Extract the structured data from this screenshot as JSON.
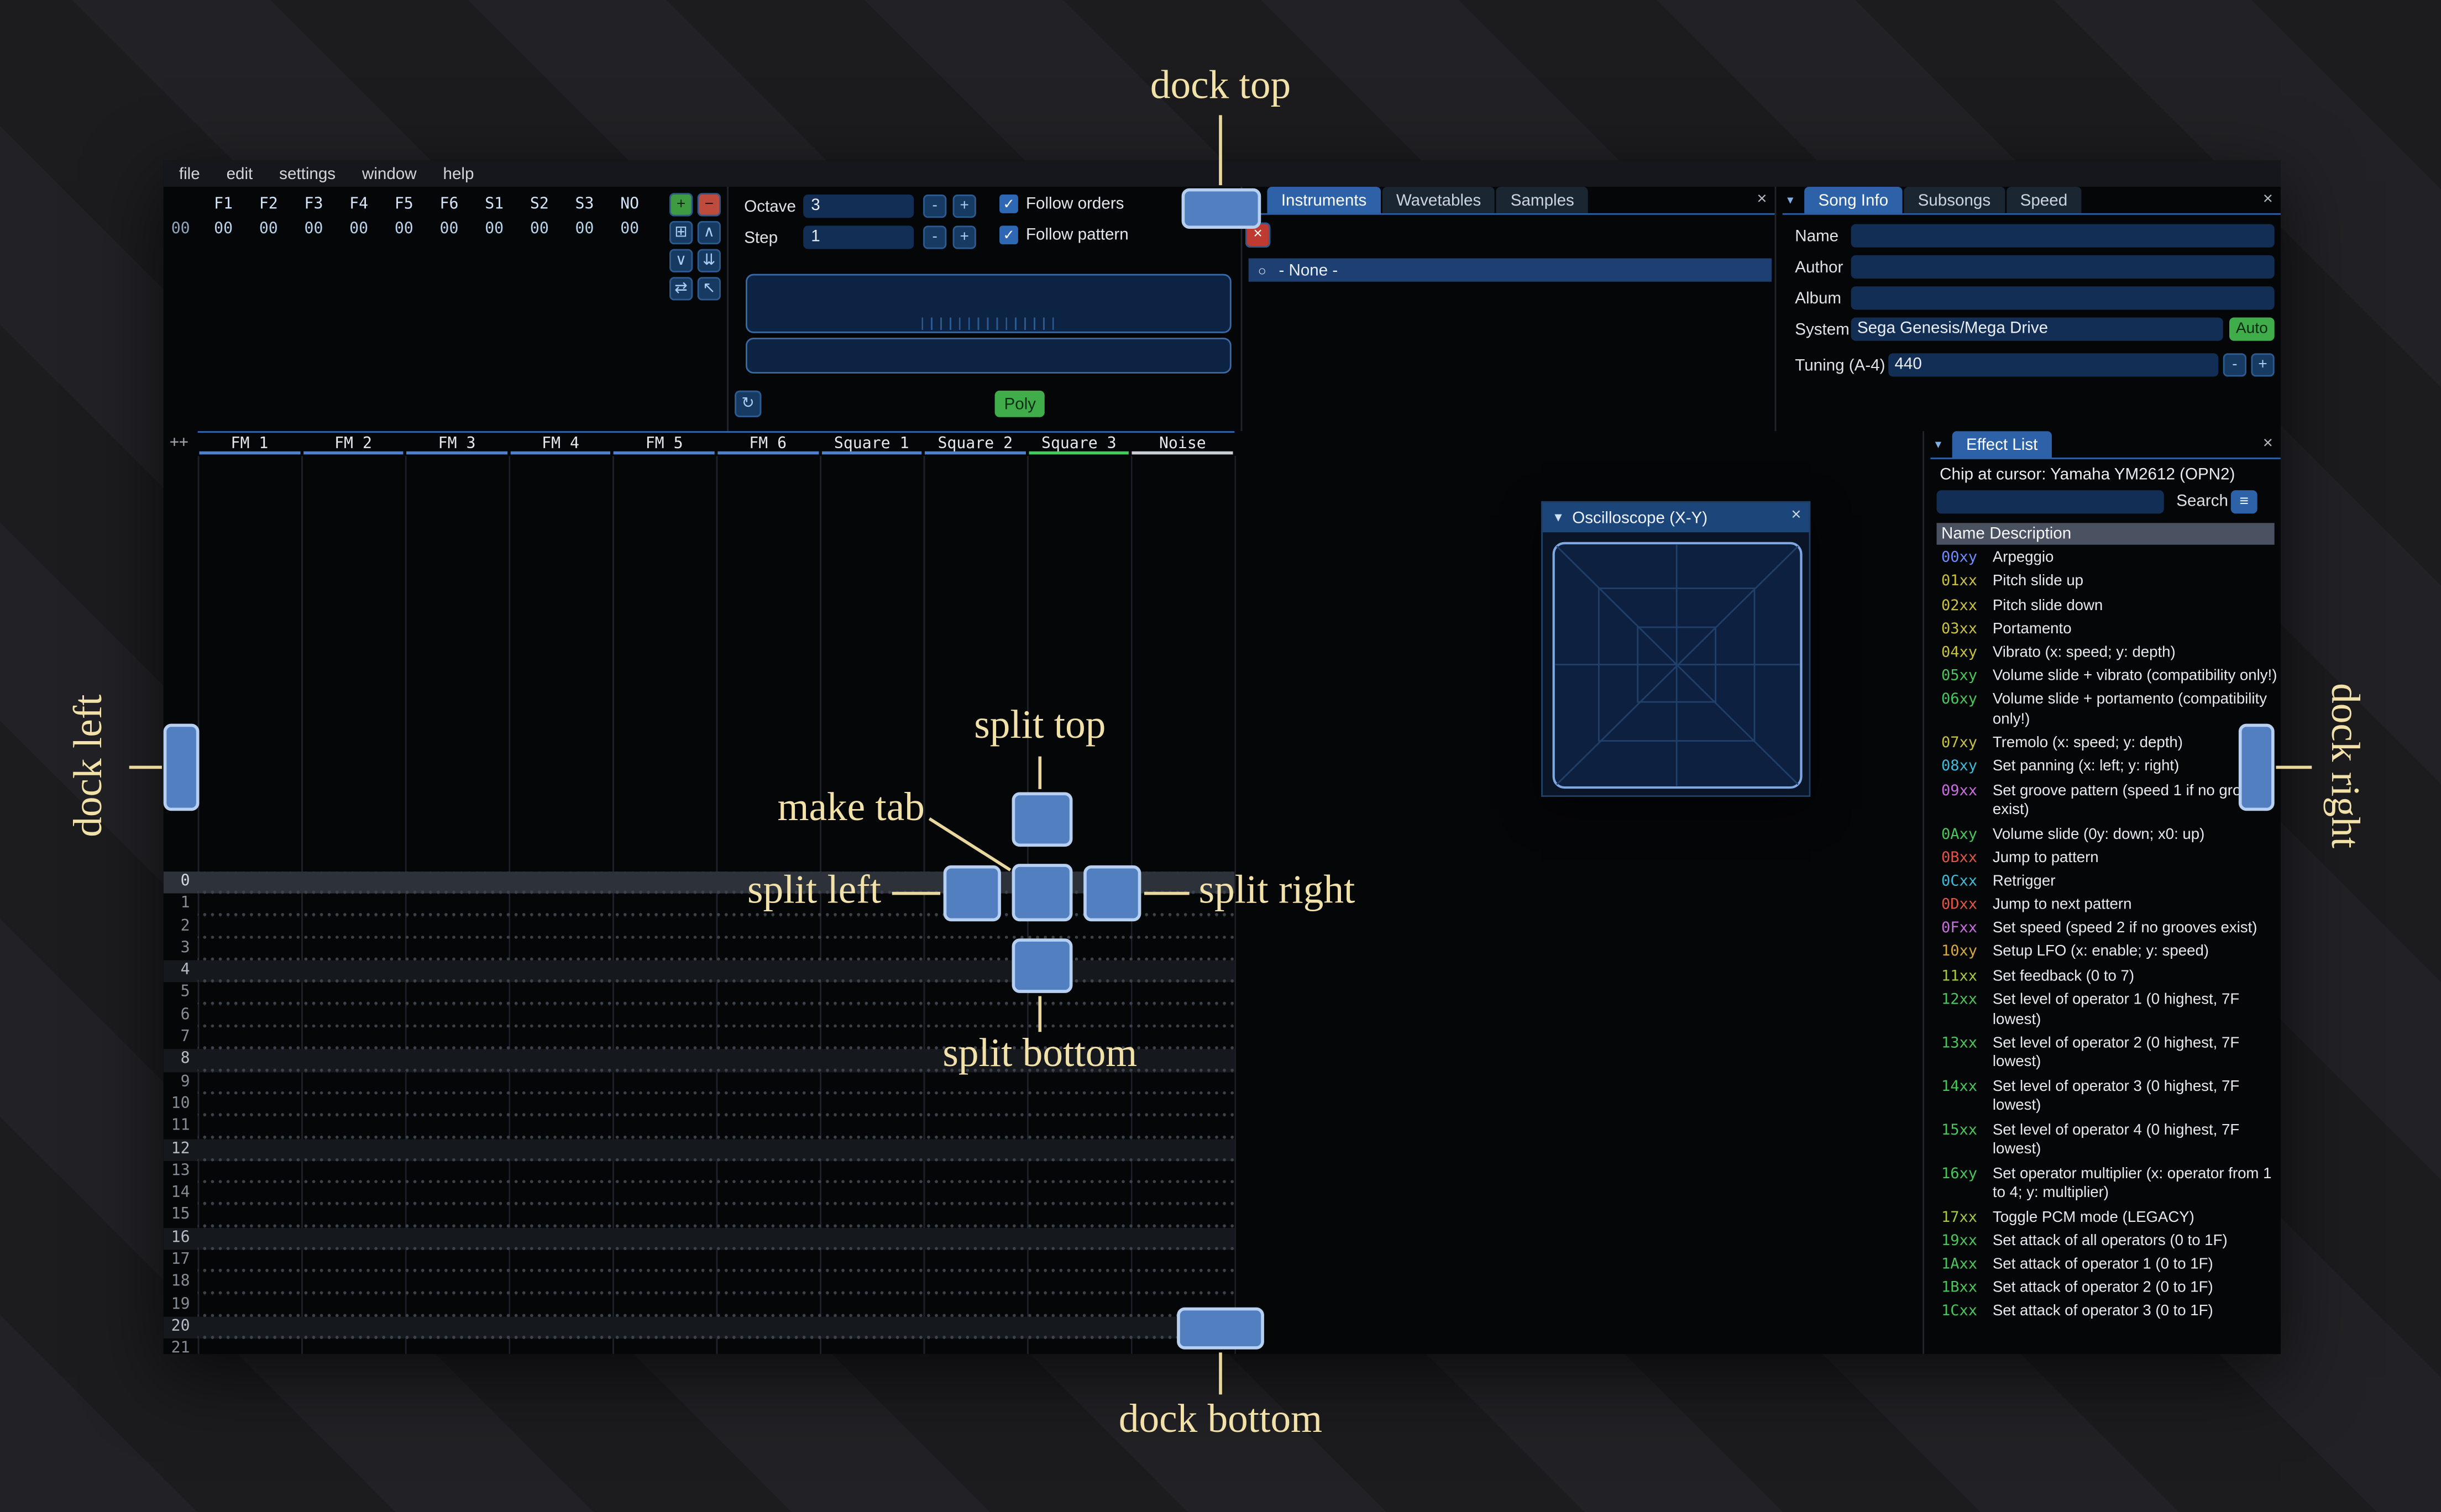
{
  "window": {
    "menu": [
      "file",
      "edit",
      "settings",
      "window",
      "help"
    ]
  },
  "glyphs": {
    "minus": "-",
    "plus": "+",
    "close": "×",
    "tab_menu": "▾",
    "collapse": "▼",
    "radio": "○",
    "hamburger": "≡",
    "check": "✓"
  },
  "orders": {
    "index": "00",
    "columns": [
      "F1",
      "F2",
      "F3",
      "F4",
      "F5",
      "F6",
      "S1",
      "S2",
      "S3",
      "NO"
    ],
    "values": [
      "00",
      "00",
      "00",
      "00",
      "00",
      "00",
      "00",
      "00",
      "00",
      "00"
    ],
    "buttons": [
      {
        "name": "order-add-button",
        "glyph": "+",
        "bg": "#3f9b41",
        "fg": "#0b2510"
      },
      {
        "name": "order-remove-button",
        "glyph": "−",
        "bg": "#bf4a3e",
        "fg": "#2a0c08"
      },
      {
        "name": "order-duplicate-button",
        "glyph": "⊞"
      },
      {
        "name": "order-move-up-button",
        "glyph": "∧"
      },
      {
        "name": "order-move-down-button",
        "glyph": "∨"
      },
      {
        "name": "order-duplicate-end-button",
        "glyph": "⇊"
      },
      {
        "name": "order-change-button",
        "glyph": "⇄"
      },
      {
        "name": "order-edit-button",
        "glyph": "↖"
      }
    ]
  },
  "transport": {
    "octave_label": "Octave",
    "octave_value": "3",
    "step_label": "Step",
    "step_value": "1",
    "follow_orders": "Follow orders",
    "follow_pattern": "Follow pattern",
    "buttons": [
      {
        "name": "play-button",
        "glyph": "▶"
      },
      {
        "name": "play-from-cursor-button",
        "glyph": "◉"
      },
      {
        "name": "play-pattern-button",
        "glyph": "↠"
      },
      {
        "name": "step-row-button",
        "glyph": "↓"
      },
      {
        "name": "record-button",
        "glyph": "●",
        "fg": "#3fd65c"
      },
      {
        "name": "metronome-button",
        "glyph": "♩"
      },
      {
        "name": "repeat-button",
        "glyph": "↻"
      }
    ],
    "poly_label": "Poly"
  },
  "instruments": {
    "tabs": [
      {
        "label": "Instruments",
        "state": "active",
        "name": "tab-instruments"
      },
      {
        "label": "Wavetables",
        "state": "",
        "name": "tab-wavetables"
      },
      {
        "label": "Samples",
        "state": "",
        "name": "tab-samples"
      }
    ],
    "toolbar": [
      {
        "name": "add-instrument-button",
        "glyph": "+"
      },
      {
        "name": "duplicate-instrument-button",
        "glyph": "⊞"
      },
      {
        "name": "open-instrument-button",
        "glyph": "▤"
      },
      {
        "name": "save-instrument-button",
        "glyph": "▦"
      },
      {
        "name": "organize-instruments-button",
        "glyph": "⊟"
      },
      {
        "name": "instrument-up-button",
        "glyph": "↑"
      },
      {
        "name": "instrument-down-button",
        "glyph": "↓"
      },
      {
        "name": "delete-instrument-button",
        "glyph": "×",
        "bg": "#bf3a30",
        "fg": "#ffffff"
      }
    ],
    "selected_item": "- None -"
  },
  "song_info": {
    "tabs": [
      {
        "label": "Song Info",
        "state": "active",
        "name": "tab-song-info"
      },
      {
        "label": "Subsongs",
        "state": "",
        "name": "tab-subsongs"
      },
      {
        "label": "Speed",
        "state": "",
        "name": "tab-speed"
      }
    ],
    "fields": [
      {
        "label": "Name",
        "value": "",
        "name": "name-input"
      },
      {
        "label": "Author",
        "value": "",
        "name": "author-input"
      },
      {
        "label": "Album",
        "value": "",
        "name": "album-input"
      }
    ],
    "system_label": "System",
    "system_value": "Sega Genesis/Mega Drive",
    "auto_label": "Auto",
    "tuning_label": "Tuning (A-4)",
    "tuning_value": "440"
  },
  "pattern": {
    "corner": "++",
    "channels": [
      {
        "label": "FM 1",
        "color": "#4d7fd6"
      },
      {
        "label": "FM 2",
        "color": "#4d7fd6"
      },
      {
        "label": "FM 3",
        "color": "#4d7fd6"
      },
      {
        "label": "FM 4",
        "color": "#4d7fd6"
      },
      {
        "label": "FM 5",
        "color": "#4d7fd6"
      },
      {
        "label": "FM 6",
        "color": "#4d7fd6"
      },
      {
        "label": "Square 1",
        "color": "#4d7fd6"
      },
      {
        "label": "Square 2",
        "color": "#4d7fd6"
      },
      {
        "label": "Square 3",
        "color": "#3fcc5c"
      },
      {
        "label": "Noise",
        "color": "#c9ced4"
      }
    ],
    "rows": [
      {
        "num": "0",
        "hl": "cursor"
      },
      {
        "num": "1",
        "hl": ""
      },
      {
        "num": "2",
        "hl": ""
      },
      {
        "num": "3",
        "hl": ""
      },
      {
        "num": "4",
        "hl": "beat"
      },
      {
        "num": "5",
        "hl": ""
      },
      {
        "num": "6",
        "hl": ""
      },
      {
        "num": "7",
        "hl": ""
      },
      {
        "num": "8",
        "hl": "beat"
      },
      {
        "num": "9",
        "hl": ""
      },
      {
        "num": "10",
        "hl": ""
      },
      {
        "num": "11",
        "hl": ""
      },
      {
        "num": "12",
        "hl": "beat"
      },
      {
        "num": "13",
        "hl": ""
      },
      {
        "num": "14",
        "hl": ""
      },
      {
        "num": "15",
        "hl": ""
      },
      {
        "num": "16",
        "hl": "beat"
      },
      {
        "num": "17",
        "hl": ""
      },
      {
        "num": "18",
        "hl": ""
      },
      {
        "num": "19",
        "hl": ""
      },
      {
        "num": "20",
        "hl": "beat"
      },
      {
        "num": "21",
        "hl": ""
      }
    ]
  },
  "oscilloscope": {
    "title": "Oscilloscope (X-Y)"
  },
  "effect_list": {
    "title": "Effect List",
    "chip_line": "Chip at cursor: Yamaha YM2612 (OPN2)",
    "search_label": "Search",
    "columns": {
      "name": "Name",
      "desc": "Description"
    },
    "rows": [
      {
        "code": "00xy",
        "color": "#6d8cff",
        "desc": "Arpeggio"
      },
      {
        "code": "01xx",
        "color": "#c9c23f",
        "desc": "Pitch slide up"
      },
      {
        "code": "02xx",
        "color": "#c9c23f",
        "desc": "Pitch slide down"
      },
      {
        "code": "03xx",
        "color": "#c9c23f",
        "desc": "Portamento"
      },
      {
        "code": "04xy",
        "color": "#c9c23f",
        "desc": "Vibrato (x: speed; y: depth)"
      },
      {
        "code": "05xy",
        "color": "#49c65b",
        "desc": "Volume slide + vibrato (compatibility only!)"
      },
      {
        "code": "06xy",
        "color": "#49c65b",
        "desc": "Volume slide + portamento (compatibility only!)"
      },
      {
        "code": "07xy",
        "color": "#c9c23f",
        "desc": "Tremolo (x: speed; y: depth)"
      },
      {
        "code": "08xy",
        "color": "#3fbbd8",
        "desc": "Set panning (x: left; y: right)"
      },
      {
        "code": "09xx",
        "color": "#c96ee0",
        "desc": "Set groove pattern (speed 1 if no grooves exist)"
      },
      {
        "code": "0Axy",
        "color": "#49c65b",
        "desc": "Volume slide (0y: down; x0: up)"
      },
      {
        "code": "0Bxx",
        "color": "#e05545",
        "desc": "Jump to pattern"
      },
      {
        "code": "0Cxx",
        "color": "#3fbbd8",
        "desc": "Retrigger"
      },
      {
        "code": "0Dxx",
        "color": "#e05545",
        "desc": "Jump to next pattern"
      },
      {
        "code": "0Fxx",
        "color": "#c96ee0",
        "desc": "Set speed (speed 2 if no grooves exist)"
      },
      {
        "code": "10xy",
        "color": "#d8a83f",
        "desc": "Setup LFO (x: enable; y: speed)"
      },
      {
        "code": "11xx",
        "color": "#a6c93f",
        "desc": "Set feedback (0 to 7)"
      },
      {
        "code": "12xx",
        "color": "#49c65b",
        "desc": "Set level of operator 1 (0 highest, 7F lowest)"
      },
      {
        "code": "13xx",
        "color": "#49c65b",
        "desc": "Set level of operator 2 (0 highest, 7F lowest)"
      },
      {
        "code": "14xx",
        "color": "#49c65b",
        "desc": "Set level of operator 3 (0 highest, 7F lowest)"
      },
      {
        "code": "15xx",
        "color": "#49c65b",
        "desc": "Set level of operator 4 (0 highest, 7F lowest)"
      },
      {
        "code": "16xy",
        "color": "#49c65b",
        "desc": "Set operator multiplier (x: operator from 1 to 4; y: multiplier)"
      },
      {
        "code": "17xx",
        "color": "#a6c93f",
        "desc": "Toggle PCM mode (LEGACY)"
      },
      {
        "code": "19xx",
        "color": "#49c65b",
        "desc": "Set attack of all operators (0 to 1F)"
      },
      {
        "code": "1Axx",
        "color": "#49c65b",
        "desc": "Set attack of operator 1 (0 to 1F)"
      },
      {
        "code": "1Bxx",
        "color": "#49c65b",
        "desc": "Set attack of operator 2 (0 to 1F)"
      },
      {
        "code": "1Cxx",
        "color": "#49c65b",
        "desc": "Set attack of operator 3 (0 to 1F)"
      }
    ]
  },
  "overlay": {
    "dock_top": "dock top",
    "dock_bottom": "dock bottom",
    "dock_left": "dock left",
    "dock_right": "dock right",
    "split_top": "split top",
    "split_bottom": "split bottom",
    "split_left": "split left",
    "split_right": "split right",
    "make_tab": "make tab",
    "accent": "#527fc0"
  }
}
